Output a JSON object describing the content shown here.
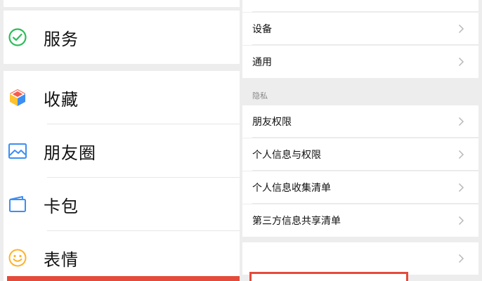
{
  "left_menu": {
    "items": [
      {
        "label": "服务"
      },
      {
        "label": "收藏"
      },
      {
        "label": "朋友圈"
      },
      {
        "label": "卡包"
      },
      {
        "label": "表情"
      }
    ]
  },
  "right_menu": {
    "general_items": [
      {
        "label": "设备"
      },
      {
        "label": "通用"
      }
    ],
    "privacy_section_title": "隐私",
    "privacy_items": [
      {
        "label": "朋友权限"
      },
      {
        "label": "个人信息与权限"
      },
      {
        "label": "个人信息收集清单"
      },
      {
        "label": "第三方信息共享清单"
      }
    ]
  },
  "colors": {
    "wechat_green": "#2bbd5a",
    "highlight_red": "#e44b3a",
    "chevron": "#b8b8b8",
    "background": "#ededed"
  }
}
